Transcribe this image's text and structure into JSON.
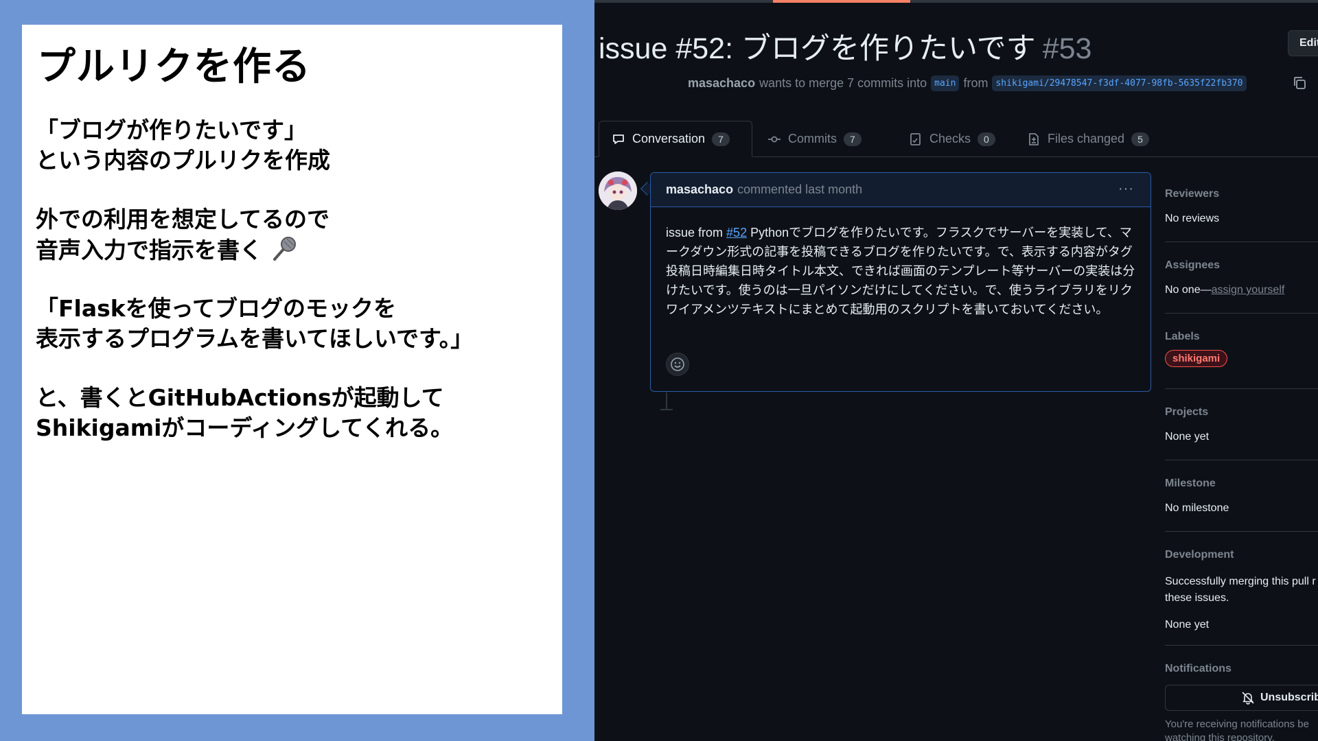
{
  "slide": {
    "title": "プルリクを作る",
    "para_1_line_1": "「ブログが作りたいです」",
    "para_1_line_2": "という内容のプルリクを作成",
    "para_2_line_1": "外での利用を想定してるので",
    "para_2_line_2": "音声入力で指示を書く",
    "para_3_line_1": "「Flaskを使ってブログのモックを",
    "para_3_line_2": "表示するプログラムを書いてほしいです。」",
    "para_4_line_1": "と、書くとGitHubActionsが起動して",
    "para_4_line_2": "Shikigamiがコーディングしてくれる。",
    "mic_icon": "microphone-icon",
    "colors": {
      "background": "#6e96d5",
      "card": "#ffffff"
    }
  },
  "github": {
    "pr_title": "issue #52: ブログを作りたいです",
    "pr_number": "#53",
    "edit_label": "Edit",
    "meta": {
      "author": "masachaco",
      "action": "wants to merge 7 commits into",
      "base_branch": "main",
      "from_word": "from",
      "head_branch": "shikigami/29478547-f3df-4077-98fb-5635f22fb370"
    },
    "tabs": [
      {
        "label": "Conversation",
        "count": "7",
        "icon": "comment-icon"
      },
      {
        "label": "Commits",
        "count": "7",
        "icon": "commit-icon"
      },
      {
        "label": "Checks",
        "count": "0",
        "icon": "checklist-icon"
      },
      {
        "label": "Files changed",
        "count": "5",
        "icon": "file-diff-icon"
      }
    ],
    "comment": {
      "author": "masachaco",
      "meta": "commented last month",
      "body_prefix": "issue from",
      "issue_link": "#52",
      "body_text": "Pythonでブログを作りたいです。フラスクでサーバーを実装して、マークダウン形式の記事を投稿できるブログを作りたいです。で、表示する内容がタグ投稿日時編集日時タイトル本文、できれば画面のテンプレート等サーバーの実装は分けたいです。使うのは一旦パイソンだけにしてください。で、使うライブラリをリクワイアメンツテキストにまとめて起動用のスクリプトを書いておいてください。",
      "menu_label": "···"
    },
    "sidebar": {
      "reviewers_head": "Reviewers",
      "reviewers_val": "No reviews",
      "assignees_head": "Assignees",
      "assignees_val": "No one—",
      "assignees_link": "assign yourself",
      "labels_head": "Labels",
      "label_name": "shikigami",
      "projects_head": "Projects",
      "projects_val": "None yet",
      "milestone_head": "Milestone",
      "milestone_val": "No milestone",
      "development_head": "Development",
      "development_text_1": "Successfully merging this pull r",
      "development_text_2": "these issues.",
      "development_val": "None yet",
      "notifications_head": "Notifications",
      "unsubscribe_label": "Unsubscrib",
      "notifications_text_1": "You're receiving notifications be",
      "notifications_text_2": "watching this repository."
    },
    "colors": {
      "background": "#0d1117",
      "accent_blue": "#58a6ff",
      "label_red": "#ff7b72",
      "tab_accent": "#f78166"
    }
  }
}
